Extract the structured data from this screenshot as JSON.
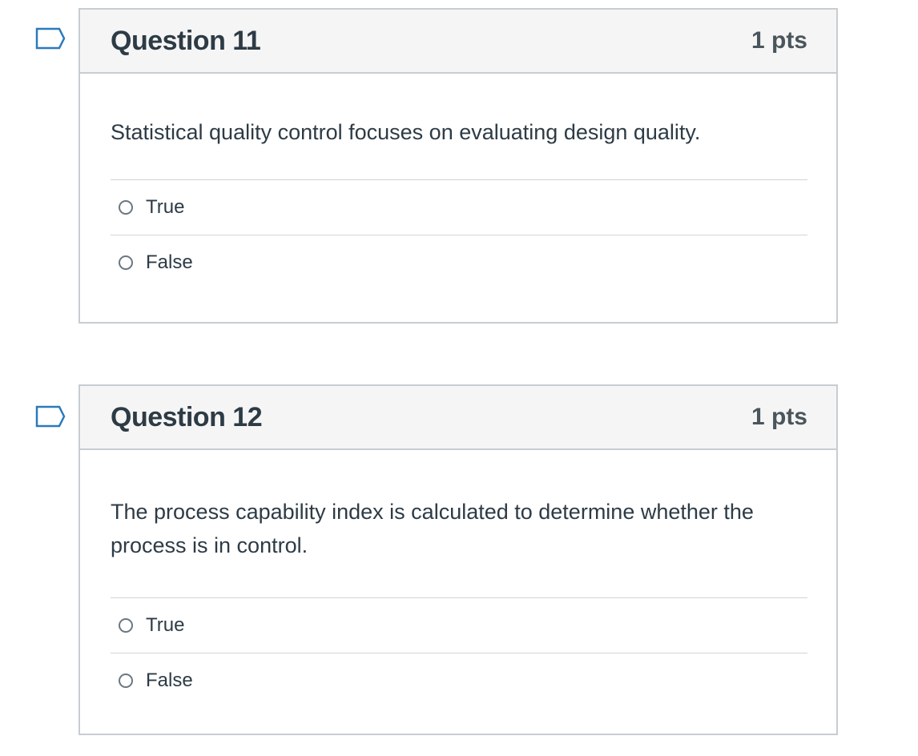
{
  "questions": [
    {
      "title": "Question 11",
      "points": "1 pts",
      "text": "Statistical quality control focuses on evaluating design quality.",
      "answers": [
        "True",
        "False"
      ],
      "flag_icon": "flag-outline-icon"
    },
    {
      "title": "Question 12",
      "points": "1 pts",
      "text": "The process capability index is calculated to determine whether the process is in control.",
      "answers": [
        "True",
        "False"
      ],
      "flag_icon": "flag-outline-icon"
    }
  ],
  "colors": {
    "flag_blue": "#2b7abc",
    "border": "#c7cdd1",
    "header_bg": "#f5f5f5",
    "text": "#2d3b45"
  }
}
